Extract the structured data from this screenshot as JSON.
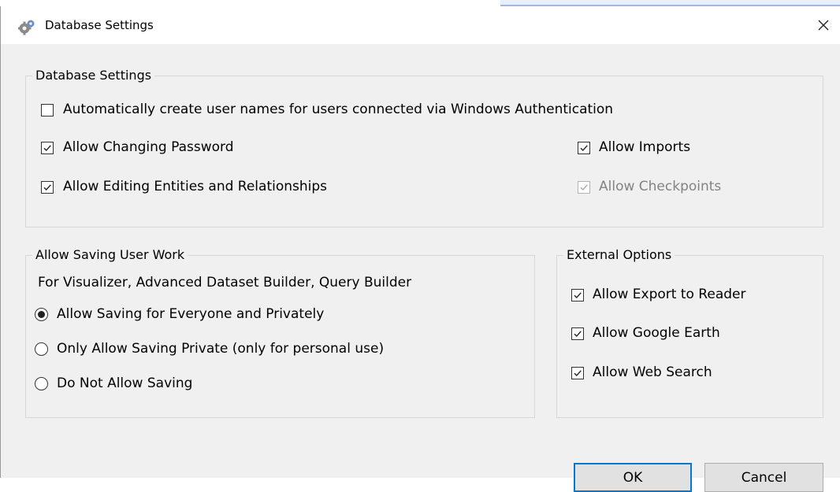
{
  "window": {
    "title": "Database Settings",
    "title_icon": "gear-icon",
    "close_icon": "close-icon"
  },
  "database_settings": {
    "legend": "Database Settings",
    "options": [
      {
        "label": "Automatically create user names for users connected via Windows Authentication",
        "checked": false,
        "enabled": true
      },
      {
        "label": "Allow Changing Password",
        "checked": true,
        "enabled": true
      },
      {
        "label": "Allow Editing Entities and Relationships",
        "checked": true,
        "enabled": true
      },
      {
        "label": "Allow Imports",
        "checked": true,
        "enabled": true
      },
      {
        "label": "Allow Checkpoints",
        "checked": true,
        "enabled": false
      }
    ]
  },
  "saving": {
    "legend": "Allow Saving User Work",
    "description": "For Visualizer, Advanced Dataset Builder, Query Builder",
    "options": [
      {
        "label": "Allow Saving for Everyone and Privately",
        "selected": true
      },
      {
        "label": "Only Allow Saving Private (only for personal use)",
        "selected": false
      },
      {
        "label": "Do Not Allow Saving",
        "selected": false
      }
    ]
  },
  "external": {
    "legend": "External Options",
    "options": [
      {
        "label": "Allow Export to Reader",
        "checked": true
      },
      {
        "label": "Allow Google Earth",
        "checked": true
      },
      {
        "label": "Allow Web Search",
        "checked": true
      }
    ]
  },
  "buttons": {
    "ok": "OK",
    "cancel": "Cancel"
  },
  "colors": {
    "dialog_bg": "#f0f0f0",
    "primary_border": "#0078d7",
    "disabled_text": "#838383"
  }
}
